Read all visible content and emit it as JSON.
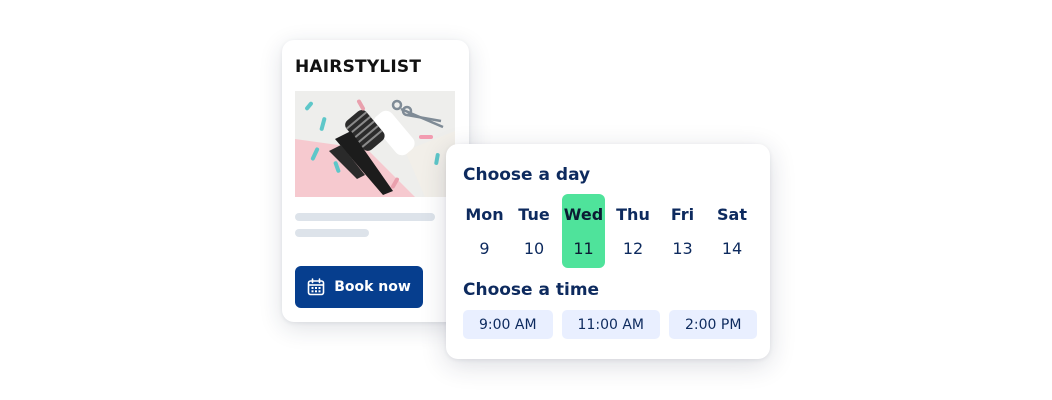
{
  "service_card": {
    "title": "HAIRSTYLIST",
    "image": "hairstyling-tools-photo",
    "book_button": {
      "label": "Book now",
      "icon": "calendar-icon"
    }
  },
  "booking_card": {
    "day_heading": "Choose a day",
    "days": [
      {
        "name": "Mon",
        "number": "9"
      },
      {
        "name": "Tue",
        "number": "10"
      },
      {
        "name": "Wed",
        "number": "11"
      },
      {
        "name": "Thu",
        "number": "12"
      },
      {
        "name": "Fri",
        "number": "13"
      },
      {
        "name": "Sat",
        "number": "14"
      }
    ],
    "selected_day_index": 2,
    "time_heading": "Choose a time",
    "times": [
      "9:00 AM",
      "11:00 AM",
      "2:00 PM"
    ]
  },
  "colors": {
    "button_bg": "#063e8e",
    "selected_day": "#4fe39b",
    "heading_text": "#0d2a5e",
    "time_chip_bg": "#e9efff"
  }
}
